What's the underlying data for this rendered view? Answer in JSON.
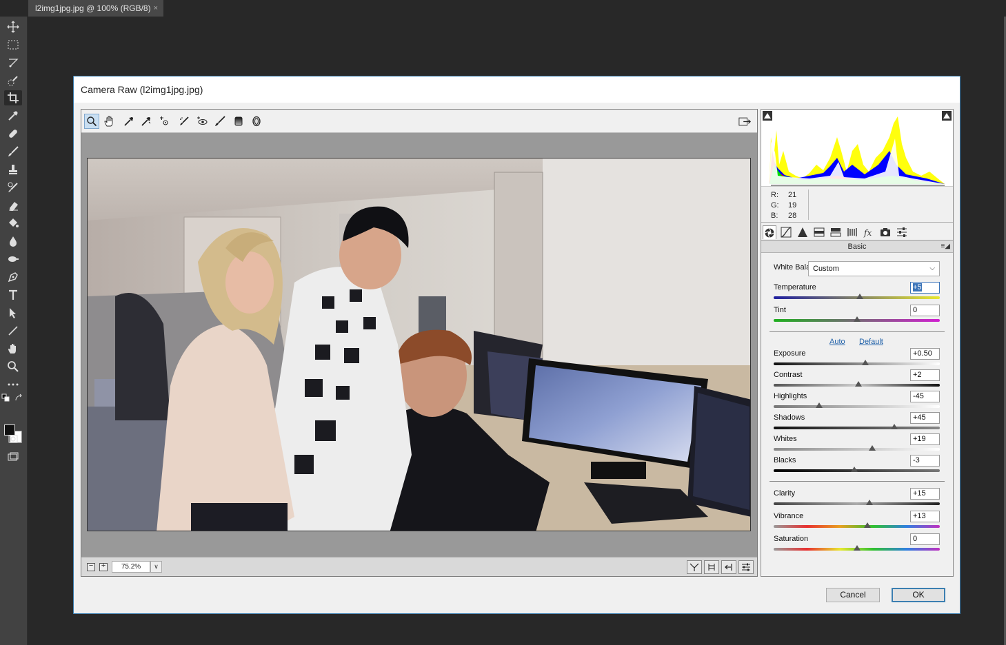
{
  "ps": {
    "tab_title": "l2img1jpg.jpg @ 100% (RGB/8)",
    "tab_close": "×",
    "tools": [
      "move-icon",
      "marquee-icon",
      "lasso-icon",
      "quick-select-icon",
      "crop-icon",
      "eyedropper-icon",
      "healing-icon",
      "brush-icon",
      "stamp-icon",
      "history-brush-icon",
      "eraser-icon",
      "paint-bucket-icon",
      "blur-icon",
      "dodge-icon",
      "pen-icon",
      "type-icon",
      "path-select-icon",
      "line-icon",
      "hand-icon",
      "zoom-icon",
      "more-icon"
    ]
  },
  "dialog": {
    "title": "Camera Raw (l2img1jpg.jpg)",
    "zoom_minus": "−",
    "zoom_plus": "+",
    "zoom_value": "75.2%",
    "zoom_dropdown": "∨",
    "cancel": "Cancel",
    "ok": "OK"
  },
  "rgb": {
    "r_label": "R:",
    "r": "21",
    "g_label": "G:",
    "g": "19",
    "b_label": "B:",
    "b": "28"
  },
  "panel": {
    "title": "Basic",
    "menu": "≡◢"
  },
  "basic": {
    "wb_label": "White Balance:",
    "wb_value": "Custom",
    "wb_chevron": "⌵",
    "auto": "Auto",
    "default": "Default",
    "temperature": {
      "label": "Temperature",
      "value": "+5",
      "level": 0.52
    },
    "tint": {
      "label": "Tint",
      "value": "0",
      "level": 0.5
    },
    "exposure": {
      "label": "Exposure",
      "value": "+0.50",
      "level": 0.55
    },
    "contrast": {
      "label": "Contrast",
      "value": "+2",
      "level": 0.51
    },
    "highlights": {
      "label": "Highlights",
      "value": "-45",
      "level": 0.275
    },
    "shadows": {
      "label": "Shadows",
      "value": "+45",
      "level": 0.725
    },
    "whites": {
      "label": "Whites",
      "value": "+19",
      "level": 0.595
    },
    "blacks": {
      "label": "Blacks",
      "value": "-3",
      "level": 0.485
    },
    "clarity": {
      "label": "Clarity",
      "value": "+15",
      "level": 0.575
    },
    "vibrance": {
      "label": "Vibrance",
      "value": "+13",
      "level": 0.565
    },
    "saturation": {
      "label": "Saturation",
      "value": "0",
      "level": 0.5
    }
  },
  "colors": {
    "accent": "#3c7fb1",
    "link": "#1d5fa8"
  }
}
